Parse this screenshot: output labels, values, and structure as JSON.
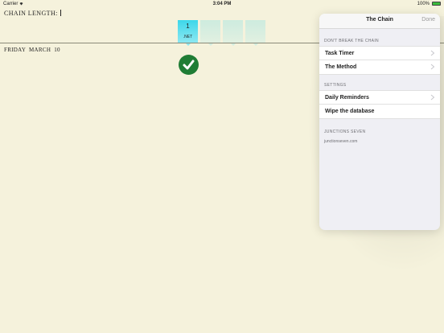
{
  "status_bar": {
    "carrier": "Carrier",
    "time": "3:04 PM",
    "battery": "100%",
    "battery_level": 1.0
  },
  "main": {
    "chain_length_label": "CHAIN LENGTH:",
    "date": {
      "day": "FRIDAY",
      "month_day": "MARCH 10"
    },
    "tiles": [
      {
        "number": "1",
        "label": ".NET"
      }
    ],
    "check_color": "#1f7d35"
  },
  "settings_panel": {
    "title": "The Chain",
    "done_label": "Done",
    "sections": [
      {
        "header": "DON'T BREAK THE CHAIN",
        "rows": [
          {
            "label": "Task Timer"
          },
          {
            "label": "The Method"
          }
        ]
      },
      {
        "header": "SETTINGS",
        "rows": [
          {
            "label": "Daily Reminders"
          },
          {
            "label": "Wipe the database"
          }
        ]
      },
      {
        "header": "JUNCTIONS SEVEN",
        "link": "junctionseven.com"
      }
    ]
  },
  "colors": {
    "background": "#f5f2dc",
    "active_tile": "#3dd7ea",
    "battery_fill": "#3cbd3c"
  }
}
